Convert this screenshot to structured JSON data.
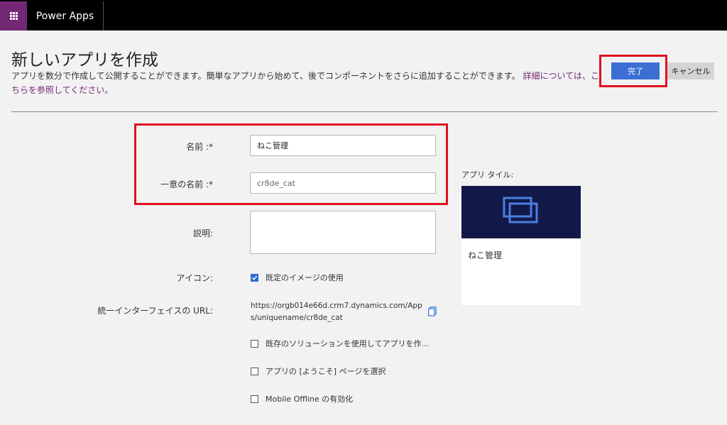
{
  "topbar": {
    "app_name": "Power Apps",
    "waffle_icon": "waffle-icon"
  },
  "header": {
    "title": "新しいアプリを作成",
    "description": "アプリを数分で作成して公開することができます。簡単なアプリから始めて、後でコンポーネントをさらに追加することができます。",
    "learn_more_link": "詳細については、こちらを参照してください。",
    "done_label": "完了",
    "cancel_label": "キャンセル"
  },
  "form": {
    "name_label": "名前 :*",
    "name_value": "ねこ管理",
    "unique_name_label": "一意の名前 :*",
    "unique_name_value": "cr8de_cat",
    "description_label": "説明:",
    "description_value": "",
    "icon_label": "アイコン:",
    "use_default_image_label": "既定のイメージの使用",
    "use_default_image_checked": true,
    "url_label": "統一インターフェイスの URL:",
    "url_value": "https://orgb014e66d.crm7.dynamics.com/Apps/uniquename/cr8de_cat",
    "copy_icon": "copy-icon",
    "options": [
      {
        "label": "既存のソリューションを使用してアプリを作...",
        "checked": false
      },
      {
        "label": "アプリの [ようこそ] ページを選択",
        "checked": false
      },
      {
        "label": "Mobile Offline の有効化",
        "checked": false
      }
    ]
  },
  "tile": {
    "label": "アプリ タイル:",
    "name": "ねこ管理",
    "icon": "app-tile-icon",
    "color": "#13184a"
  },
  "colors": {
    "accent": "#3b6fd3",
    "brand": "#742774",
    "highlight": "#e0111f"
  }
}
